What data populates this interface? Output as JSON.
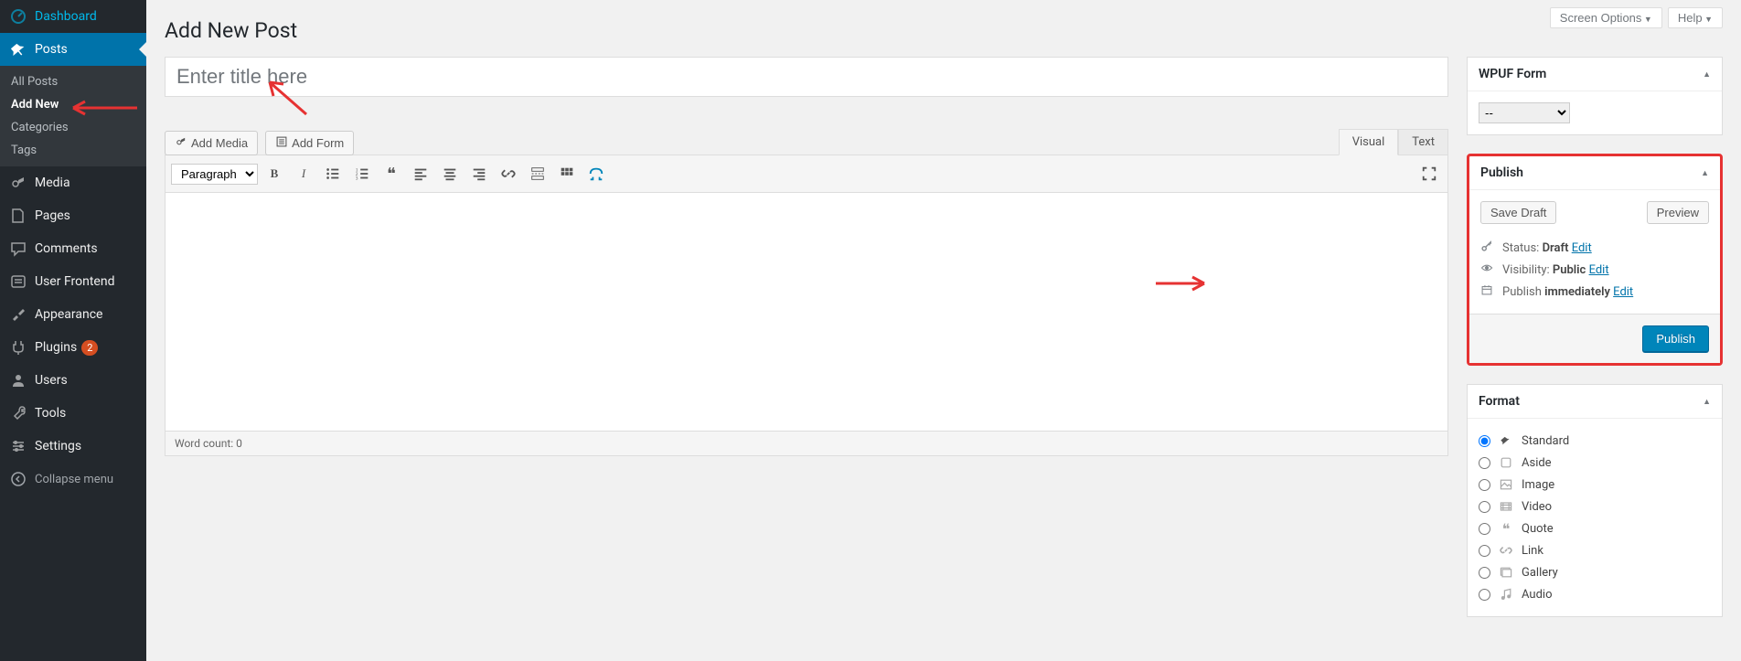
{
  "topTabs": {
    "screenOptions": "Screen Options",
    "help": "Help"
  },
  "sidebar": {
    "items": [
      {
        "label": "Dashboard"
      },
      {
        "label": "Posts"
      },
      {
        "label": "Media"
      },
      {
        "label": "Pages"
      },
      {
        "label": "Comments"
      },
      {
        "label": "User Frontend"
      },
      {
        "label": "Appearance"
      },
      {
        "label": "Plugins",
        "badge": "2"
      },
      {
        "label": "Users"
      },
      {
        "label": "Tools"
      },
      {
        "label": "Settings"
      }
    ],
    "submenu": [
      {
        "label": "All Posts"
      },
      {
        "label": "Add New"
      },
      {
        "label": "Categories"
      },
      {
        "label": "Tags"
      }
    ],
    "collapse": "Collapse menu"
  },
  "page": {
    "title": "Add New Post",
    "titlePlaceholder": "Enter title here"
  },
  "editor": {
    "addMedia": "Add Media",
    "addForm": "Add Form",
    "visualTab": "Visual",
    "textTab": "Text",
    "paragraph": "Paragraph",
    "wordCount": "Word count: 0"
  },
  "wpuf": {
    "title": "WPUF Form",
    "option": "--"
  },
  "publish": {
    "title": "Publish",
    "saveDraft": "Save Draft",
    "preview": "Preview",
    "statusLabel": "Status:",
    "statusValue": "Draft",
    "visibilityLabel": "Visibility:",
    "visibilityValue": "Public",
    "publishLabel": "Publish",
    "publishValue": "immediately",
    "edit": "Edit",
    "publishBtn": "Publish"
  },
  "format": {
    "title": "Format",
    "options": [
      "Standard",
      "Aside",
      "Image",
      "Video",
      "Quote",
      "Link",
      "Gallery",
      "Audio"
    ]
  }
}
